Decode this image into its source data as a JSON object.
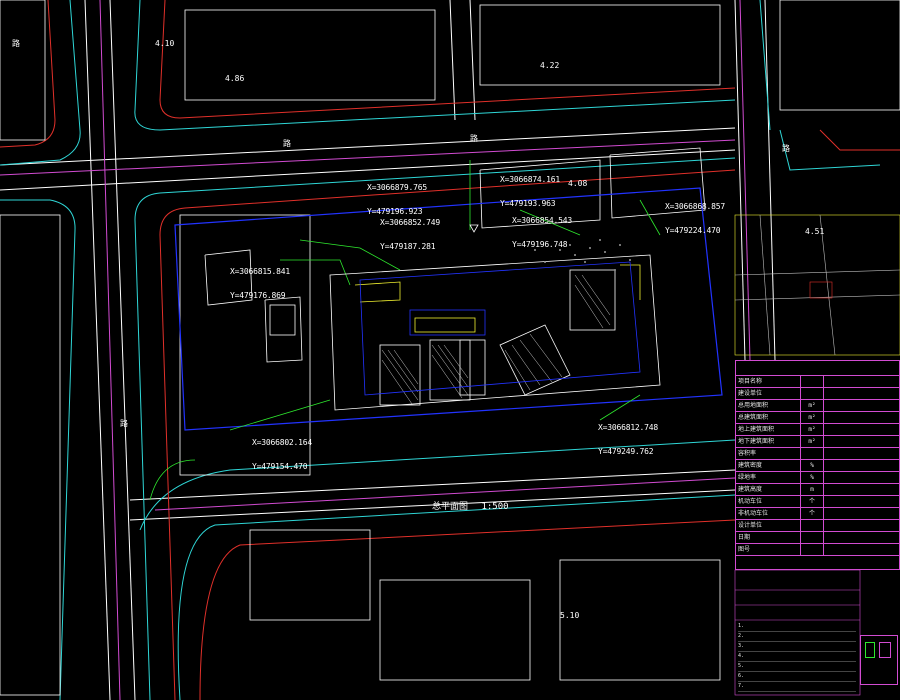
{
  "plan": {
    "title": "总平面图",
    "scale": "1:500",
    "road_labels": [
      "路",
      "路",
      "路",
      "路",
      "路"
    ],
    "elevations": [
      "4.10",
      "4.86",
      "4.22",
      "4.08",
      "4.51",
      "5.10"
    ]
  },
  "coordinates": [
    {
      "x": "X=3066879.765",
      "y": "Y=479196.923"
    },
    {
      "x": "X=3066874.161",
      "y": "Y=479193.963"
    },
    {
      "x": "X=3066852.749",
      "y": "Y=479187.281"
    },
    {
      "x": "X=3066854.543",
      "y": "Y=479196.748"
    },
    {
      "x": "X=3066868.857",
      "y": "Y=479224.470"
    },
    {
      "x": "X=3066815.841",
      "y": "Y=479176.869"
    },
    {
      "x": "X=3066802.164",
      "y": "Y=479154.470"
    },
    {
      "x": "X=3066812.748",
      "y": "Y=479249.762"
    }
  ],
  "title_block": {
    "rows": [
      [
        "项目名称",
        "",
        ""
      ],
      [
        "建设单位",
        "",
        ""
      ],
      [
        "总用地面积",
        "m²",
        ""
      ],
      [
        "总建筑面积",
        "m²",
        ""
      ],
      [
        "地上建筑面积",
        "m²",
        ""
      ],
      [
        "地下建筑面积",
        "m²",
        ""
      ],
      [
        "容积率",
        "",
        ""
      ],
      [
        "建筑密度",
        "%",
        ""
      ],
      [
        "绿地率",
        "%",
        ""
      ],
      [
        "建筑高度",
        "m",
        ""
      ],
      [
        "机动车位",
        "个",
        ""
      ],
      [
        "非机动车位",
        "个",
        ""
      ],
      [
        "设计单位",
        "",
        ""
      ],
      [
        "日期",
        "",
        ""
      ],
      [
        "图号",
        "",
        ""
      ]
    ]
  },
  "notes": [
    "1.",
    "2.",
    "3.",
    "4.",
    "5.",
    "6.",
    "7."
  ],
  "colors": {
    "background": "#000000",
    "road": "#ffffff",
    "curb": "#2fd6d6",
    "redline": "#e0302a",
    "boundary": "#d24cd2",
    "building": "#ffffff",
    "site": "#2233ff",
    "green": "#2ee82e",
    "yellow": "#f0f030"
  }
}
